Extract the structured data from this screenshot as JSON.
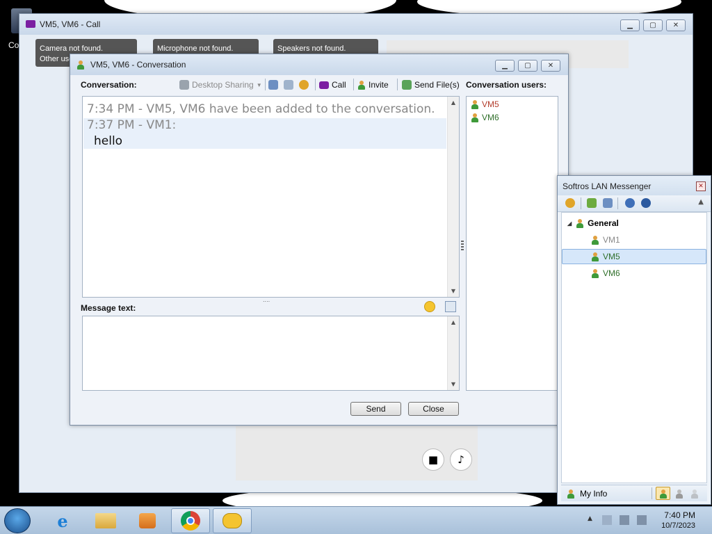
{
  "desktop": {
    "icon_label": "Co"
  },
  "call_window": {
    "title": "VM5, VM6 - Call",
    "notices": [
      {
        "line1": "Camera not found.",
        "line2": "Other use"
      },
      {
        "line1": "Microphone not found.",
        "line2": ""
      },
      {
        "line1": "Speakers not found.",
        "line2": ""
      }
    ]
  },
  "conversation_window": {
    "title": "VM5, VM6 - Conversation",
    "conversation_label": "Conversation:",
    "toolbar": {
      "desktop_sharing": "Desktop Sharing",
      "call": "Call",
      "invite": "Invite",
      "send_files": "Send File(s)"
    },
    "messages": [
      {
        "header": "7:34 PM - VM5, VM6 have been added to the conversation.",
        "body": ""
      },
      {
        "header": "7:37 PM - VM1:",
        "body": "hello"
      }
    ],
    "message_text_label": "Message text:",
    "message_value": "",
    "users_label": "Conversation users:",
    "users": [
      "VM5",
      "VM6"
    ],
    "send_label": "Send",
    "close_label": "Close"
  },
  "messenger": {
    "title": "Softros LAN Messenger",
    "group": "General",
    "contacts": [
      {
        "name": "VM1",
        "status": "offline",
        "selected": false
      },
      {
        "name": "VM5",
        "status": "online",
        "selected": true
      },
      {
        "name": "VM6",
        "status": "online",
        "selected": false
      }
    ],
    "my_info_label": "My Info"
  },
  "taskbar": {
    "time": "7:40 PM",
    "date": "10/7/2023"
  },
  "colors": {
    "accent_purple": "#7b1fa2",
    "selection_blue": "#d6e7fa",
    "contact_online": "#2f6f2a"
  }
}
